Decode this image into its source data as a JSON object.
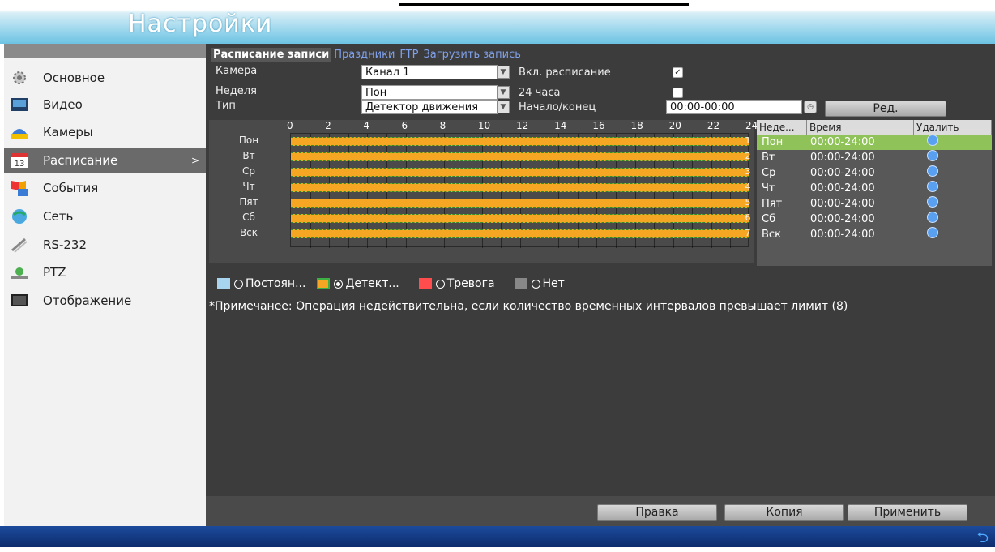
{
  "window": {
    "title": "Настройки"
  },
  "sidebar": {
    "items": [
      {
        "label": "Основное",
        "icon": "gear-icon"
      },
      {
        "label": "Видео",
        "icon": "video-icon"
      },
      {
        "label": "Камеры",
        "icon": "camera-icon"
      },
      {
        "label": "Расписание",
        "icon": "calendar-icon",
        "active": true,
        "arrow": ">"
      },
      {
        "label": "События",
        "icon": "events-icon"
      },
      {
        "label": "Сеть",
        "icon": "network-icon"
      },
      {
        "label": "RS-232",
        "icon": "rs232-icon"
      },
      {
        "label": "PTZ",
        "icon": "ptz-icon"
      },
      {
        "label": "Отображение",
        "icon": "display-icon"
      }
    ]
  },
  "tabs": [
    {
      "label": "Расписание записи",
      "active": true
    },
    {
      "label": "Праздники",
      "active": false
    },
    {
      "label": "FTP",
      "active": false
    },
    {
      "label": "Загрузить запись",
      "active": false
    }
  ],
  "form": {
    "camera_label": "Камера",
    "camera_value": "Канал 1",
    "enable_label": "Вкл. расписание",
    "enable_checked": "✓",
    "week_label": "Неделя",
    "week_value": "Пон",
    "h24_label": "24 часа",
    "type_label": "Тип",
    "type_value": "Детектор движения",
    "startend_label": "Начало/конец",
    "startend_value": "00:00-00:00",
    "edit_button": "Ред."
  },
  "schedule": {
    "hours": [
      "0",
      "2",
      "4",
      "6",
      "8",
      "10",
      "12",
      "14",
      "16",
      "18",
      "20",
      "22",
      "24"
    ],
    "days": [
      "Пон",
      "Вт",
      "Ср",
      "Чт",
      "Пят",
      "Сб",
      "Вск"
    ],
    "row_numbers": [
      "1",
      "2",
      "3",
      "4",
      "5",
      "6",
      "7"
    ],
    "fill_color": "#f5a623"
  },
  "table": {
    "headers": [
      "Неде...",
      "Время",
      "Удалить"
    ],
    "rows": [
      {
        "day": "Пон",
        "time": "00:00-24:00"
      },
      {
        "day": "Вт",
        "time": "00:00-24:00"
      },
      {
        "day": "Ср",
        "time": "00:00-24:00"
      },
      {
        "day": "Чт",
        "time": "00:00-24:00"
      },
      {
        "day": "Пят",
        "time": "00:00-24:00"
      },
      {
        "day": "Сб",
        "time": "00:00-24:00"
      },
      {
        "day": "Вск",
        "time": "00:00-24:00"
      }
    ]
  },
  "legend": [
    {
      "label": "Постоян...",
      "color": "#a8d4f0",
      "selected": false
    },
    {
      "label": "Детект...",
      "color": "#f5a623",
      "selected": true
    },
    {
      "label": "Тревога",
      "color": "#ff4d4d",
      "selected": false
    },
    {
      "label": "Нет",
      "color": "#888888",
      "selected": false
    }
  ],
  "note": "*Примечанее: Операция недействительна, если количество временных интервалов превышает лимит (8)",
  "buttons": {
    "edit": "Правка",
    "copy": "Копия",
    "apply": "Применить"
  },
  "footer": {
    "back_icon": "back-arrow-icon"
  }
}
